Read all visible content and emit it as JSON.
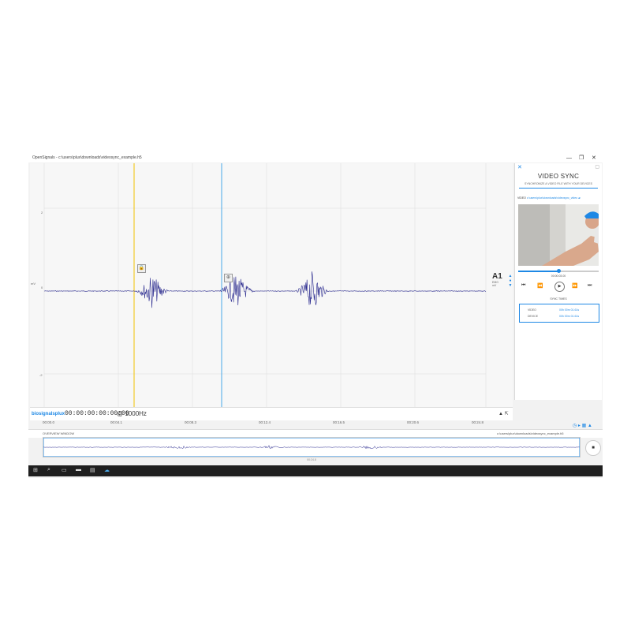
{
  "window": {
    "title": "OpenSignals - c:\\users\\plux\\downloads\\videosync_example.h5",
    "controls": [
      "—",
      "❐",
      "✕"
    ]
  },
  "plot": {
    "y_ticks": [
      "2",
      "0",
      "-2"
    ],
    "y_unit": "mV",
    "channel_name": "A1",
    "channel_sub": [
      "EMG",
      "mV"
    ],
    "channel_controls": [
      "▲",
      "●",
      "▼"
    ],
    "marker1_icon": "lock-icon",
    "marker2_icon": "crosshair-icon",
    "colors": {
      "signal": "#2b2b8f",
      "cursor_yellow": "#f2c200",
      "cursor_blue": "#4aa8e8",
      "accent": "#1e88e5"
    }
  },
  "timebar": {
    "logo": "biosignalsplux",
    "timecode": "00:00:00:00:00:00",
    "rate": "@ 1000Hz",
    "corner_label": "▲ ⇱"
  },
  "time_ticks": [
    "00:00.0",
    "00:04.1",
    "00:08.3",
    "00:12.4",
    "00:16.5",
    "00:20.6",
    "00:24.8"
  ],
  "panel": {
    "title": "VIDEO SYNC",
    "subtitle": "SYNCHRONIZE A VIDEO FILE WITH YOUR DEVICES",
    "video_label": "VIDEO",
    "video_path": "c:\\users\\plux\\downloads\\videosync_video",
    "video_time": "00:00:03.00",
    "seek_fraction": 0.5,
    "controls": [
      "⏮",
      "⏪",
      "▶",
      "⏩",
      "⏭"
    ],
    "sync_label": "SYNC TIMES",
    "sync_rows": [
      {
        "label": "VIDEO",
        "value": "00h 00m 01.61s"
      },
      {
        "label": "DEVICE",
        "value": "00h 00m 01.61s"
      }
    ]
  },
  "overview": {
    "label": "OVERVIEW WINDOW",
    "file": "c:\\users\\plux\\downloads\\videosync_example.h5",
    "time": "00:24.8",
    "icons": "◷ ▸ ▦ ▲"
  },
  "stop_icon": "■",
  "taskbar": [
    "⊞",
    "⌕",
    "▭",
    "▬",
    "▤",
    "☁"
  ]
}
